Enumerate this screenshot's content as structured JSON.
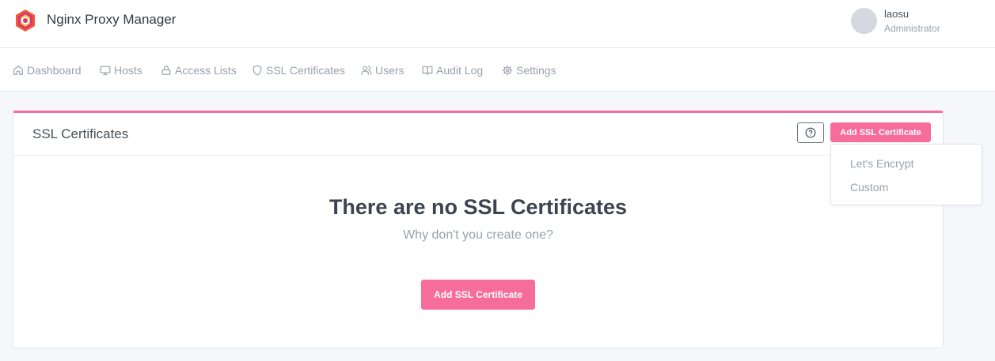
{
  "app": {
    "title": "Nginx Proxy Manager"
  },
  "user": {
    "name": "laosu",
    "role": "Administrator"
  },
  "nav": {
    "items": [
      {
        "label": "Dashboard",
        "icon": "home-icon"
      },
      {
        "label": "Hosts",
        "icon": "monitor-icon"
      },
      {
        "label": "Access Lists",
        "icon": "lock-icon"
      },
      {
        "label": "SSL Certificates",
        "icon": "shield-icon"
      },
      {
        "label": "Users",
        "icon": "users-icon"
      },
      {
        "label": "Audit Log",
        "icon": "book-icon"
      },
      {
        "label": "Settings",
        "icon": "gear-icon"
      }
    ]
  },
  "card": {
    "title": "SSL Certificates",
    "add_button": "Add SSL Certificate",
    "help_icon": "help-circle-icon",
    "empty_title": "There are no SSL Certificates",
    "empty_subtitle": "Why don't you create one?",
    "empty_button": "Add SSL Certificate"
  },
  "dropdown": {
    "items": [
      "Let's Encrypt",
      "Custom"
    ]
  },
  "colors": {
    "accent": "#f66d9b",
    "muted_text": "#9aa0ac",
    "background": "#f5f7fb"
  }
}
